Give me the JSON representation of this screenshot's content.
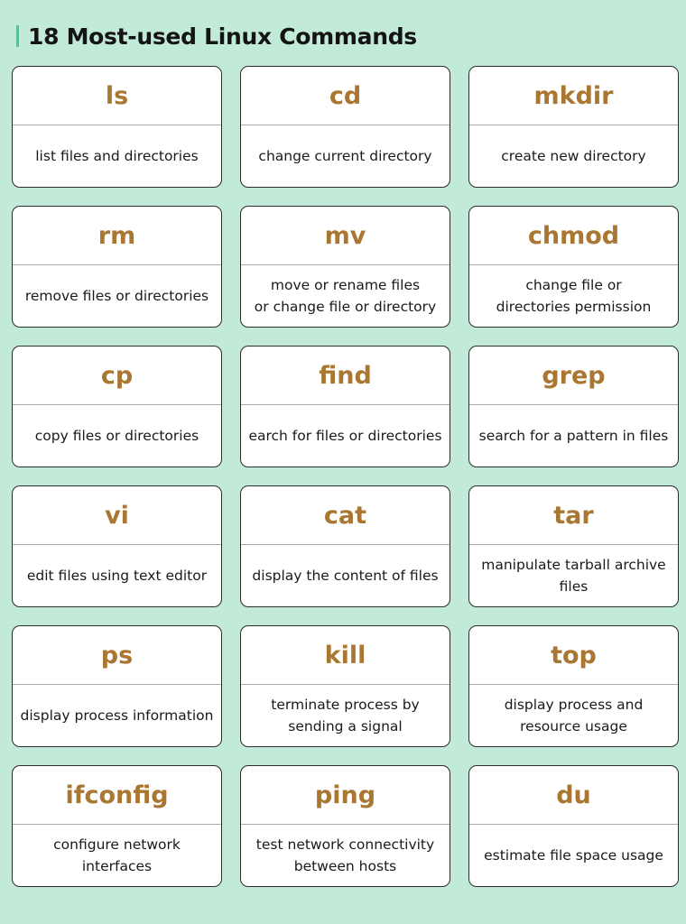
{
  "title": "18 Most-used Linux Commands",
  "colors": {
    "background": "#c2ead8",
    "command": "#a97731",
    "accent_bar": "#5bbf91"
  },
  "commands": [
    {
      "name": "ls",
      "desc": "list files and directories"
    },
    {
      "name": "cd",
      "desc": "change current directory"
    },
    {
      "name": "mkdir",
      "desc": "create new directory"
    },
    {
      "name": "rm",
      "desc": "remove files or directories"
    },
    {
      "name": "mv",
      "desc": "move or rename files\nor change file or directory"
    },
    {
      "name": "chmod",
      "desc": "change file or\ndirectories permission"
    },
    {
      "name": "cp",
      "desc": "copy files or directories"
    },
    {
      "name": "find",
      "desc": "earch for files or directories"
    },
    {
      "name": "grep",
      "desc": "search for a pattern in files"
    },
    {
      "name": "vi",
      "desc": "edit files using text editor"
    },
    {
      "name": "cat",
      "desc": "display the content of files"
    },
    {
      "name": "tar",
      "desc": "manipulate tarball archive\nfiles"
    },
    {
      "name": "ps",
      "desc": "display process information"
    },
    {
      "name": "kill",
      "desc": "terminate process by\nsending a signal"
    },
    {
      "name": "top",
      "desc": "display process and\nresource usage"
    },
    {
      "name": "ifconfig",
      "desc": "configure network\ninterfaces"
    },
    {
      "name": "ping",
      "desc": "test network connectivity\nbetween hosts"
    },
    {
      "name": "du",
      "desc": "estimate file space usage"
    }
  ]
}
